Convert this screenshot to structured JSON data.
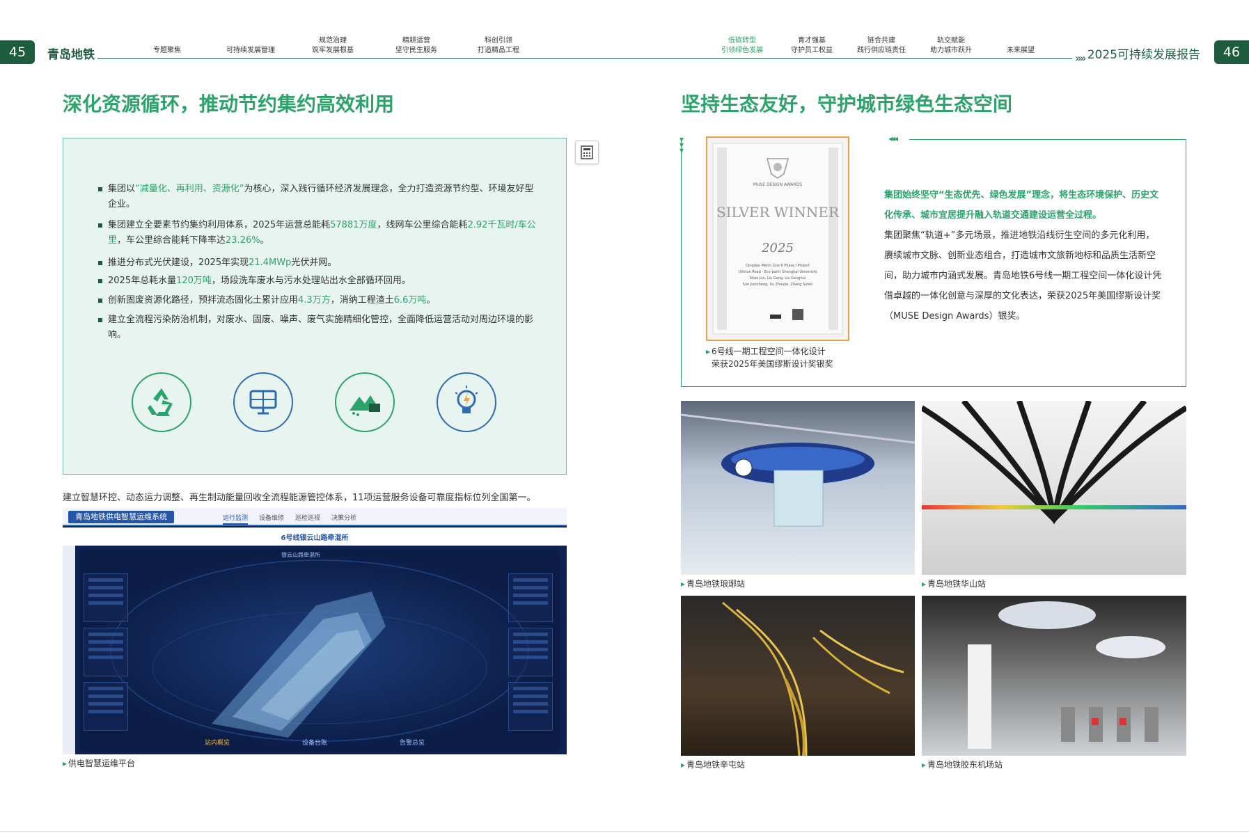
{
  "header": {
    "page_left": "45",
    "page_right": "46",
    "brand": "青岛地铁",
    "report_title": "2025可持续发展报告",
    "nav": [
      {
        "line1": "",
        "line2": "专题聚焦",
        "active": false
      },
      {
        "line1": "",
        "line2": "可持续发展管理",
        "active": false
      },
      {
        "line1": "规范治理",
        "line2": "筑牢发展根基",
        "active": false
      },
      {
        "line1": "精耕运营",
        "line2": "坚守民生服务",
        "active": false
      },
      {
        "line1": "科创引领",
        "line2": "打造精品工程",
        "active": false
      },
      {
        "line1": "低碳转型",
        "line2": "引领绿色发展",
        "active": true
      },
      {
        "line1": "育才强基",
        "line2": "守护员工权益",
        "active": false
      },
      {
        "line1": "链合共建",
        "line2": "践行供应链责任",
        "active": false
      },
      {
        "line1": "轨交赋能",
        "line2": "助力城市跃升",
        "active": false
      },
      {
        "line1": "",
        "line2": "未来展望",
        "active": false
      }
    ]
  },
  "left": {
    "title": "深化资源循环，推动节约集约高效利用",
    "bullets": [
      {
        "parts": [
          [
            "集团以",
            false
          ],
          [
            "“减量化、再利用、资源化”",
            true
          ],
          [
            "为核心，深入践行循环经济发展理念，全力打造资源节约型、环境友好型企业。",
            false
          ]
        ]
      },
      {
        "parts": [
          [
            "集团建立全要素节约集约利用体系，2025年运营总能耗",
            false
          ],
          [
            "57881万度",
            true
          ],
          [
            "，线网车公里综合能耗",
            false
          ],
          [
            "2.92千瓦时/车公里",
            true
          ],
          [
            "，车公里综合能耗下降率达",
            false
          ],
          [
            "23.26%",
            true
          ],
          [
            "。",
            false
          ]
        ]
      },
      {
        "parts": [
          [
            "推进分布式光伏建设，2025年实现",
            false
          ],
          [
            "21.4MWp",
            true
          ],
          [
            "光伏并网。",
            false
          ]
        ]
      },
      {
        "parts": [
          [
            "2025年总耗水量",
            false
          ],
          [
            "120万吨",
            true
          ],
          [
            "，场段洗车废水与污水处理站出水全部循环回用。",
            false
          ]
        ]
      },
      {
        "parts": [
          [
            "创新固废资源化路径，预拌流态固化土累计应用",
            false
          ],
          [
            "4.3万方",
            true
          ],
          [
            "，消纳工程渣土",
            false
          ],
          [
            "6.6万吨",
            true
          ],
          [
            "。",
            false
          ]
        ]
      },
      {
        "parts": [
          [
            "建立全流程污染防治机制，对废水、固废、噪声、废气实施精细化管控，全面降低运营活动对周边环境的影响。",
            false
          ]
        ]
      }
    ],
    "icons": [
      "recycle-icon",
      "solar-panel-icon",
      "waste-recycling-icon",
      "energy-bulb-icon"
    ],
    "caption": "建立智慧环控、动态运力调整、再生制动能量回收全流程能源管控体系，11项运营服务设备可靠度指标位列全国第一。",
    "dashboard_caption": "供电智慧运维平台",
    "dashboard": {
      "title": "青岛地铁供电智慧运维系统",
      "tabs": [
        "运行监测",
        "设备维修",
        "巡检巡视",
        "决策分析"
      ],
      "station": "6号线银云山路牵混所",
      "hall": "银云山路牵混所",
      "bottom": [
        "站内概览",
        "设备台账",
        "告警总览"
      ]
    }
  },
  "right": {
    "title": "坚持生态友好，守护城市绿色生态空间",
    "award": {
      "brand": "MUSE DESIGN AWARDS",
      "level": "SILVER WINNER",
      "year": "2025",
      "project": "Qingdao Metro Line 6 Phase I Project",
      "venue": "(Xintun Road - Eco-park) Shanghai University",
      "people1": "Shao Jun, Liu Gang, Liu Genghui",
      "people2": "Sun Jiancheng, Xu Zhoujie, Zhang Sufan"
    },
    "award_caption_1": "6号线一期工程空间一体化设计",
    "award_caption_2": "荣获2025年美国缪斯设计奖银奖",
    "para_hl": "集团始终坚守“生态优先、绿色发展”理念，将生态环境保护、历史文化传承、城市宜居提升融入轨道交通建设运营全过程。",
    "para": "集团聚焦“轨道+”多元场景，推进地铁沿线衍生空间的多元化利用，赓续城市文脉、创新业态组合，打造城市文旅新地标和品质生活新空间，助力城市内涵式发展。青岛地铁6号线一期工程空间一体化设计凭借卓越的一体化创意与深厚的文化表达，荣获2025年美国缪斯设计奖（MUSE Design Awards）银奖。",
    "photos": [
      {
        "caption": "青岛地铁琅琊站"
      },
      {
        "caption": "青岛地铁华山站"
      },
      {
        "caption": "青岛地铁辛屯站"
      },
      {
        "caption": "青岛地铁胶东机场站"
      }
    ]
  },
  "colors": {
    "brand_green": "#1e5c3f",
    "accent_green": "#2ba36a",
    "box_bg": "#e8f4ef",
    "blue": "#2d6cb5",
    "award_border": "#e8a34a"
  }
}
